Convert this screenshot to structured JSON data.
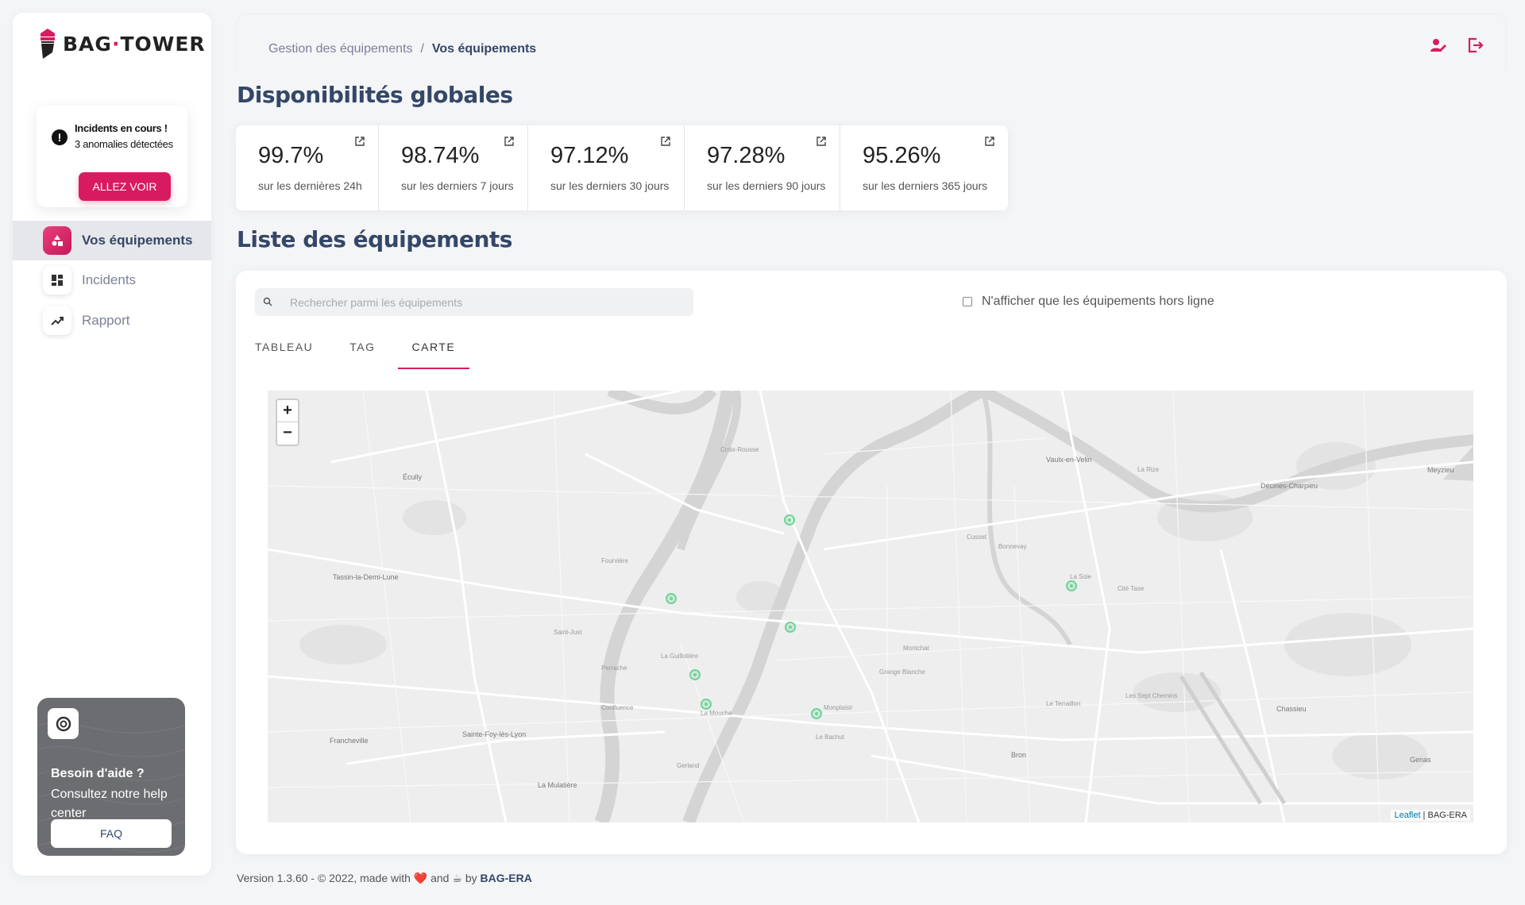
{
  "brand": {
    "name_left": "BAG",
    "name_dot": "·",
    "name_right": "TOWER"
  },
  "incident_card": {
    "title": "Incidents en cours !",
    "subtitle": "3 anomalies détectées",
    "button": "ALLEZ VOIR"
  },
  "nav": [
    {
      "label": "Vos équipements",
      "icon": "shapes-icon",
      "active": true
    },
    {
      "label": "Incidents",
      "icon": "dashboard-icon",
      "active": false
    },
    {
      "label": "Rapport",
      "icon": "trending-icon",
      "active": false
    }
  ],
  "help": {
    "title": "Besoin d'aide ?",
    "subtitle": "Consultez notre help center",
    "button": "FAQ"
  },
  "breadcrumb": {
    "parent": "Gestion des équipements",
    "sep": "/",
    "current": "Vos équipements"
  },
  "sections": {
    "availability_title": "Disponibilités globales",
    "list_title": "Liste des équipements"
  },
  "stats": [
    {
      "value": "99.7%",
      "caption": "sur les dernières 24h"
    },
    {
      "value": "98.74%",
      "caption": "sur les derniers 7 jours"
    },
    {
      "value": "97.12%",
      "caption": "sur les derniers 30 jours"
    },
    {
      "value": "97.28%",
      "caption": "sur les derniers 90 jours"
    },
    {
      "value": "95.26%",
      "caption": "sur les derniers 365 jours"
    }
  ],
  "list": {
    "search_placeholder": "Rechercher parmi les équipements",
    "filter_label": "N'afficher que les équipements hors ligne",
    "tabs": [
      "TABLEAU",
      "TAG",
      "CARTE"
    ],
    "active_tab": "CARTE"
  },
  "map": {
    "zoom_in": "+",
    "zoom_out": "−",
    "attribution_link": "Leaflet",
    "attribution_sep": " | ",
    "attribution_text": "BAG-ERA",
    "places": [
      "Écully",
      "Vaulx-en-Velin",
      "Décines-Charpieu",
      "Meyzieu",
      "Tassin-la-Demi-Lune",
      "Francheville",
      "Sainte-Foy-lès-Lyon",
      "La Mulatière",
      "Bron",
      "Chassieu",
      "Genas",
      "Le Terraillon",
      "Les Sept Chemins",
      "La Soie",
      "Cité Tase",
      "Montchat",
      "Monplaisir",
      "La Guillotière",
      "Perrache",
      "Confluence",
      "La Mouche",
      "Gerland",
      "Fourvière",
      "Cusset",
      "Bonnevay",
      "La Rize",
      "Croix-Rousse",
      "Grange Blanche",
      "Le Bachut",
      "Saint-Just"
    ],
    "markers": 7
  },
  "footer": {
    "prefix": "Version 1.3.60 - © 2022, made with",
    "heart": "❤️",
    "and": "and",
    "coffee": "☕",
    "by": "by",
    "company": "BAG-ERA"
  },
  "colors": {
    "accent": "#d81b60",
    "heading": "#344767",
    "marker": "#6fd39a"
  }
}
